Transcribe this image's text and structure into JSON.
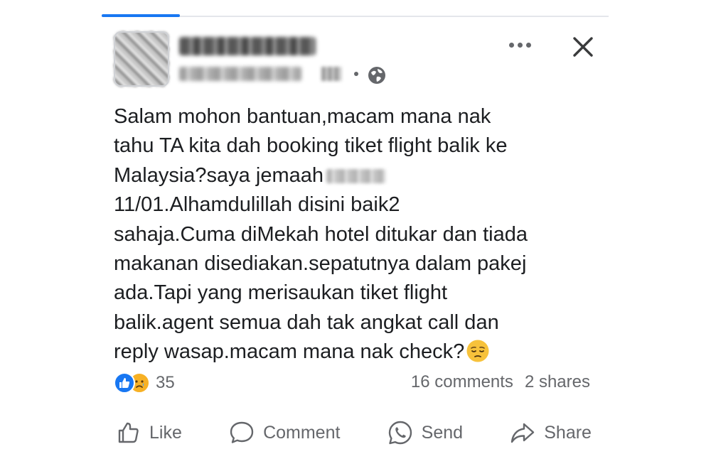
{
  "post": {
    "text_lines": [
      "Salam mohon bantuan,macam mana nak",
      "tahu TA kita dah booking tiket flight balik ke",
      "Malaysia?saya jemaah",
      "11/01.Alhamdulillah disini baik2",
      "sahaja.Cuma diMekah hotel ditukar dan tiada",
      "makanan disediakan.sepatutnya dalam pakej",
      "ada.Tapi yang merisaukan tiket flight",
      "balik.agent semua dah tak angkat call dan",
      "reply wasap.macam mana nak check?"
    ],
    "emoji": "pensive-face-icon"
  },
  "stats": {
    "reaction_count": "35",
    "comments": "16 comments",
    "shares": "2 shares"
  },
  "actions": {
    "like": "Like",
    "comment": "Comment",
    "send": "Send",
    "share": "Share"
  },
  "colors": {
    "accent": "#1877f2",
    "text": "#1c1e21",
    "muted": "#65676b",
    "sad_reaction": "#f7b125"
  }
}
